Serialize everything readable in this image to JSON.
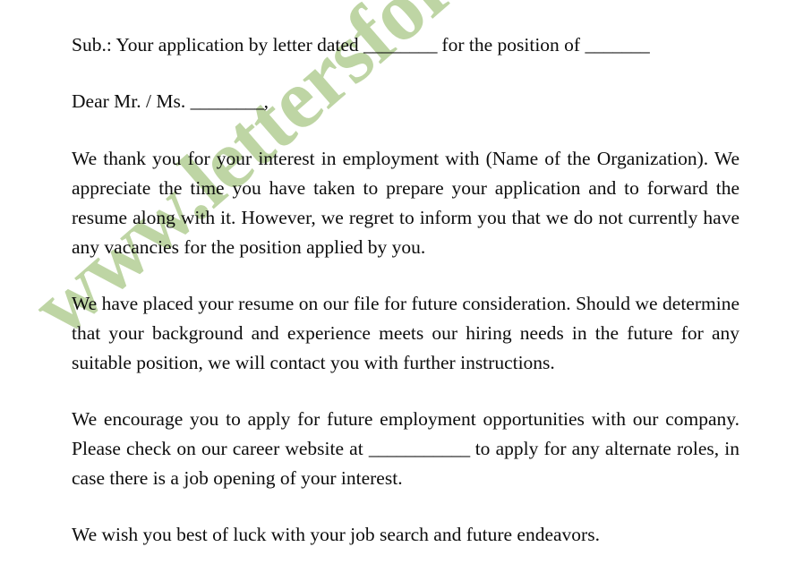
{
  "document": {
    "type": "letter",
    "subject_line": {
      "prefix": "Sub.: Your application by letter dated ",
      "blank1": "________",
      "middle": " for the position of ",
      "blank2": "_______"
    },
    "salutation": {
      "text": "Dear Mr. / Ms. ",
      "blank": "________",
      "suffix": ","
    },
    "paragraphs": [
      {
        "id": "paragraph-1",
        "text": "We thank you for your interest in employment with (Name of the Organization). We appreciate the time you have taken to prepare your application and to forward the resume along with it. However, we regret to inform you that we do not currently have any vacancies for the position applied by you."
      },
      {
        "id": "paragraph-2",
        "text": "We have placed your resume on our file for future consideration. Should we determine that your background and experience meets our hiring needs in the future for any suitable position, we will contact you with further instructions."
      }
    ],
    "paragraph_3": {
      "id": "paragraph-3",
      "part1": "We encourage you to apply for future employment opportunities with our company. Please check on our career website at ",
      "blank": "___________",
      "part2": " to apply for any alternate roles, in case there is a job opening of your interest."
    },
    "closing_line": {
      "id": "closing-line",
      "text": "We wish you best of luck with your job search and future endeavors."
    }
  },
  "watermark": {
    "text": "www.lettersformats.com",
    "color": "#bed5a4"
  },
  "colors": {
    "background": "#ffffff",
    "text": "#0d0d0d",
    "watermark": "#bed5a4"
  }
}
